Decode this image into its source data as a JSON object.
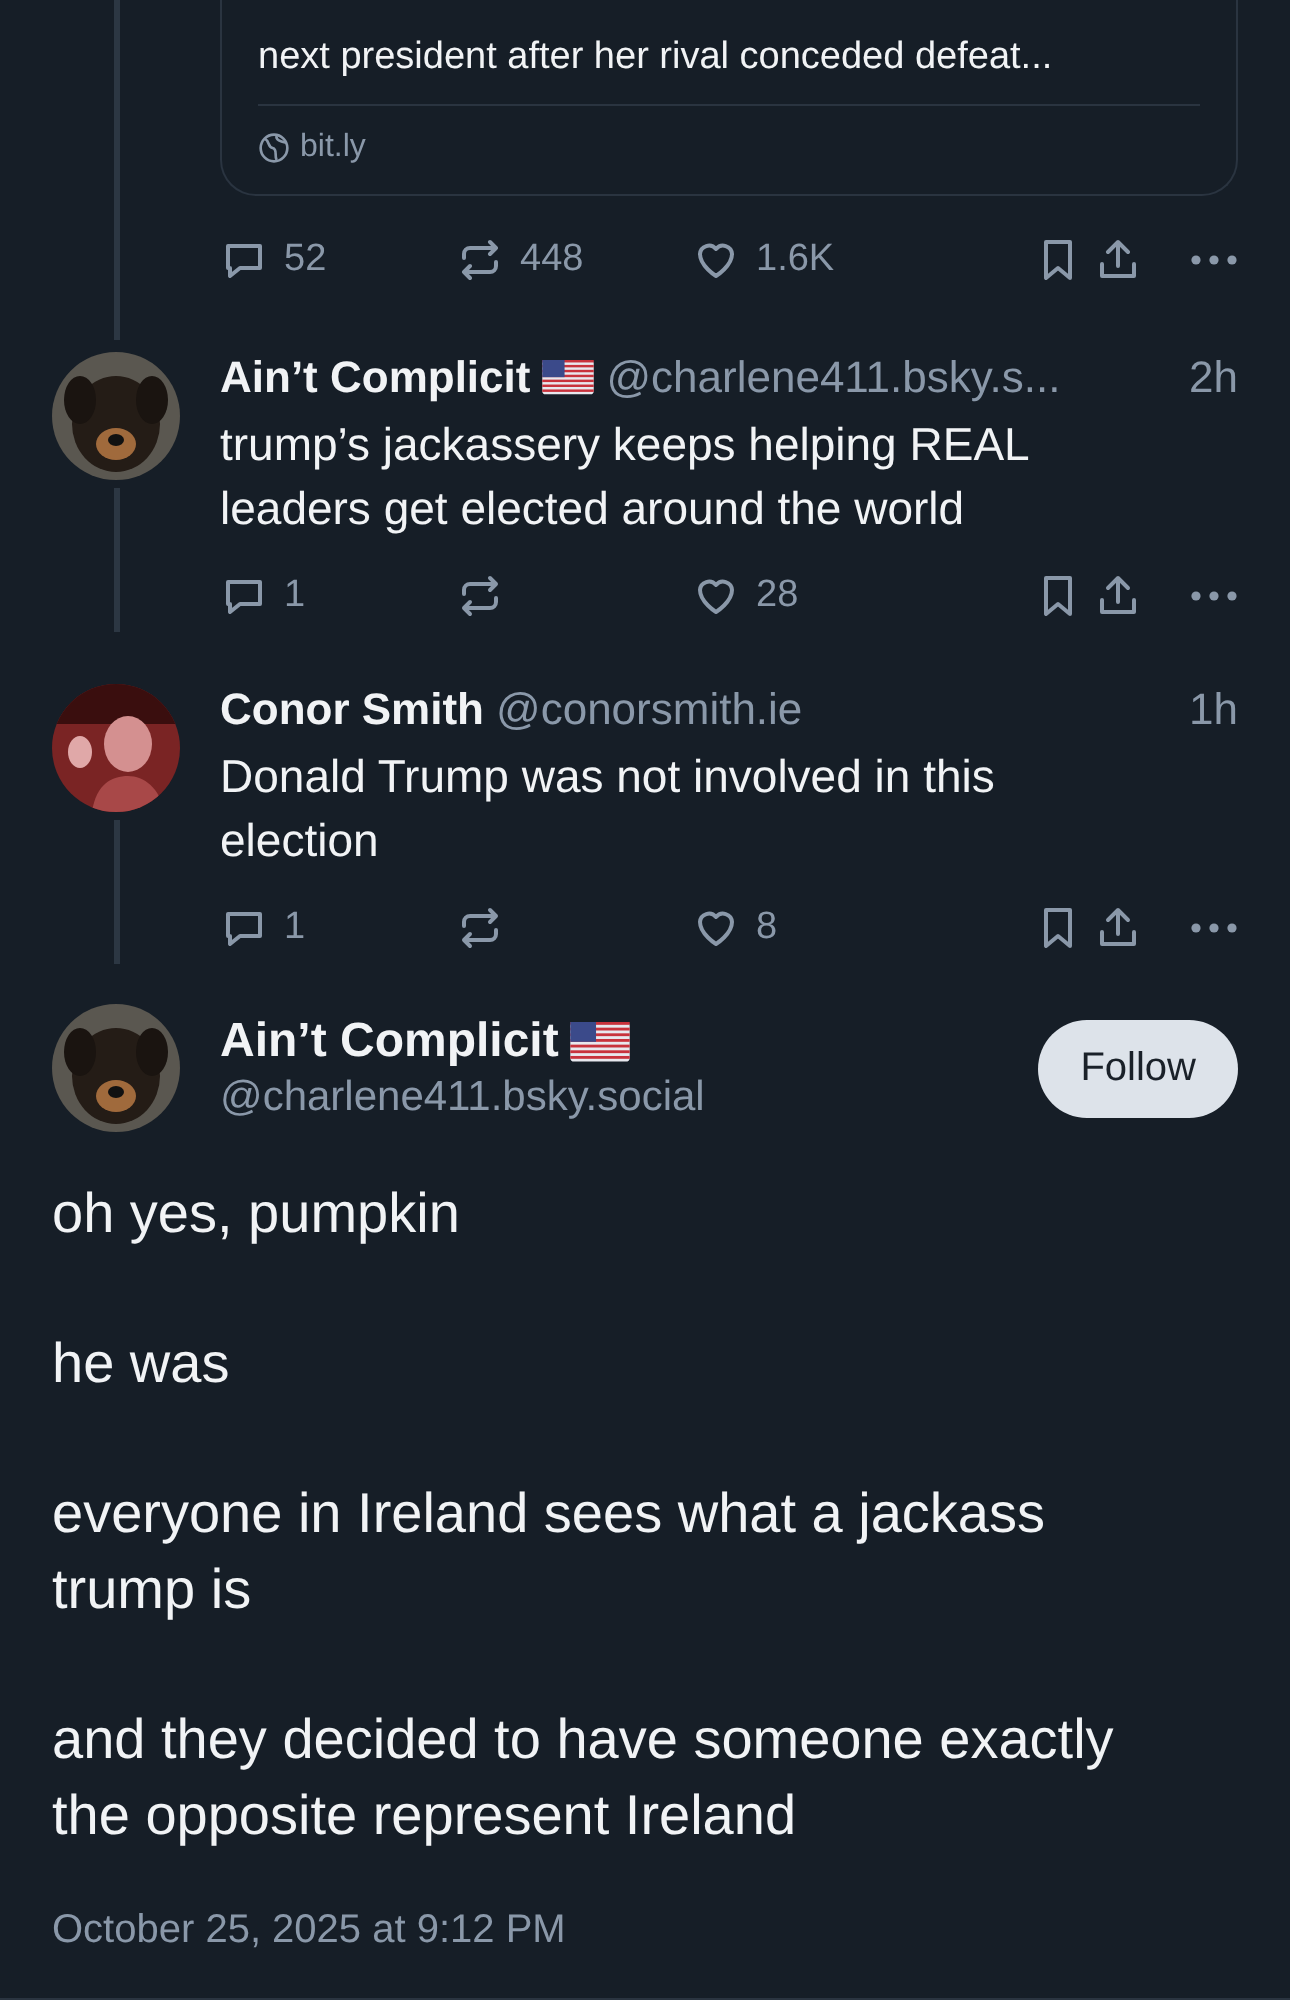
{
  "link_card": {
    "description": "next president after her rival conceded defeat...",
    "domain": "bit.ly"
  },
  "top_stats": {
    "replies": "52",
    "reposts": "448",
    "likes": "1.6K"
  },
  "replies": [
    {
      "name": "Ain’t Complicit",
      "flag": true,
      "handle": "@charlene411.bsky.s...",
      "time": "2h",
      "text": "trump’s jackassery keeps helping REAL leaders get elected around the world",
      "stats": {
        "replies": "1",
        "likes": "28"
      }
    },
    {
      "name": "Conor Smith",
      "flag": false,
      "handle": "@conorsmith.ie",
      "time": "1h",
      "text": "Donald Trump was not involved in this election",
      "stats": {
        "replies": "1",
        "likes": "8"
      }
    }
  ],
  "main_post": {
    "name": "Ain’t Complicit",
    "flag": true,
    "handle": "@charlene411.bsky.social",
    "follow_label": "Follow",
    "paragraphs": [
      "oh yes, pumpkin",
      "he was",
      "everyone in Ireland sees what a jackass trump is",
      "and they decided to have someone exactly the opposite represent Ireland"
    ],
    "timestamp": "October 25, 2025 at 9:12 PM"
  }
}
